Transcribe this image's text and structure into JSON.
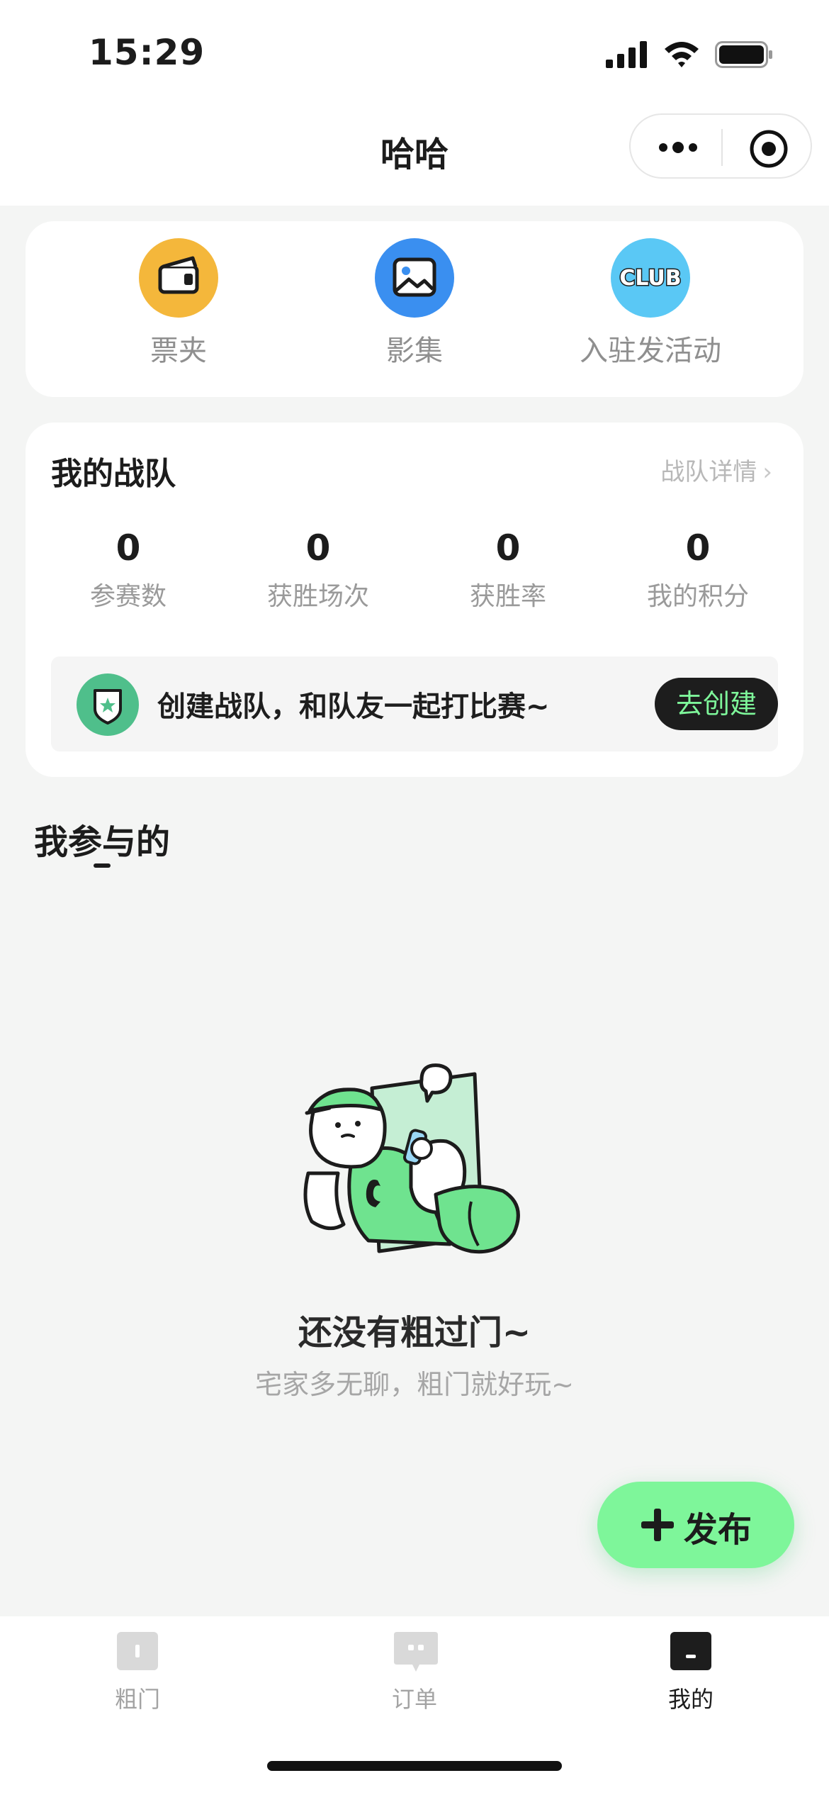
{
  "status_bar": {
    "time": "15:29"
  },
  "nav": {
    "title": "哈哈"
  },
  "quick_actions": [
    {
      "label": "票夹",
      "icon": "ticket-wallet-icon",
      "color": "#f4b73b"
    },
    {
      "label": "影集",
      "icon": "photo-album-icon",
      "color": "#3a8ff0"
    },
    {
      "label": "入驻发活动",
      "icon": "club-icon",
      "color": "#5ac8f5",
      "icon_text": "CLUB"
    }
  ],
  "team": {
    "title": "我的战队",
    "detail_link": "战队详情",
    "stats": [
      {
        "value": "0",
        "label": "参赛数"
      },
      {
        "value": "0",
        "label": "获胜场次"
      },
      {
        "value": "0",
        "label": "获胜率"
      },
      {
        "value": "0",
        "label": "我的积分"
      }
    ],
    "create_banner": {
      "text": "创建战队，和队友一起打比赛~",
      "button": "去创建"
    }
  },
  "participated": {
    "title": "我参与的",
    "empty_title": "还没有粗过门~",
    "empty_subtitle": "宅家多无聊，粗门就好玩~"
  },
  "fab": {
    "label": "发布"
  },
  "tabs": [
    {
      "label": "粗门",
      "icon": "home-tab-icon",
      "active": false
    },
    {
      "label": "订单",
      "icon": "order-tab-icon",
      "active": false
    },
    {
      "label": "我的",
      "icon": "profile-tab-icon",
      "active": true
    }
  ],
  "colors": {
    "accent": "#7ef69a",
    "dark": "#1d1d1d",
    "background": "#f4f5f4"
  }
}
